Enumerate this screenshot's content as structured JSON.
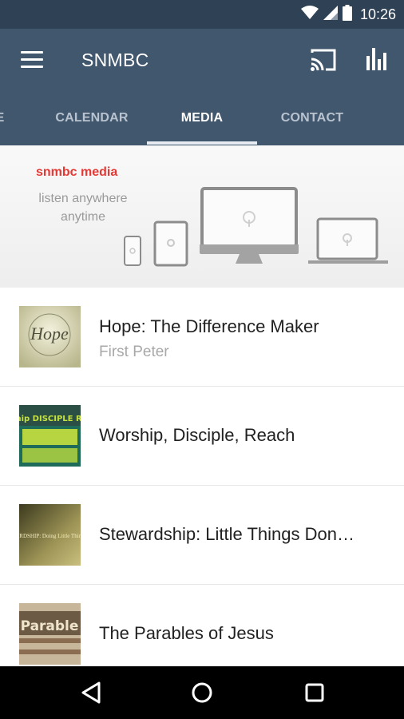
{
  "status": {
    "time": "10:26"
  },
  "appbar": {
    "title": "SNMBC"
  },
  "tabs": [
    {
      "label": "E"
    },
    {
      "label": "CALENDAR"
    },
    {
      "label": "MEDIA"
    },
    {
      "label": "CONTACT"
    }
  ],
  "banner": {
    "title": "snmbc media",
    "subtitle": "listen anywhere anytime"
  },
  "media_items": [
    {
      "title": "Hope: The Difference Maker",
      "subtitle": "First Peter",
      "thumb_text": "Hope"
    },
    {
      "title": "Worship, Disciple, Reach",
      "subtitle": "",
      "thumb_text": "Worship DISCIPLE REACH"
    },
    {
      "title": "Stewardship: Little Things Don…",
      "subtitle": "",
      "thumb_text": "STEWARDSHIP: Doing Little Things Well"
    },
    {
      "title": "The Parables of Jesus",
      "subtitle": "",
      "thumb_text": "Parable"
    }
  ],
  "colors": {
    "statusbar": "#2f4154",
    "appbar": "#41576e",
    "accent_red": "#e53935"
  }
}
